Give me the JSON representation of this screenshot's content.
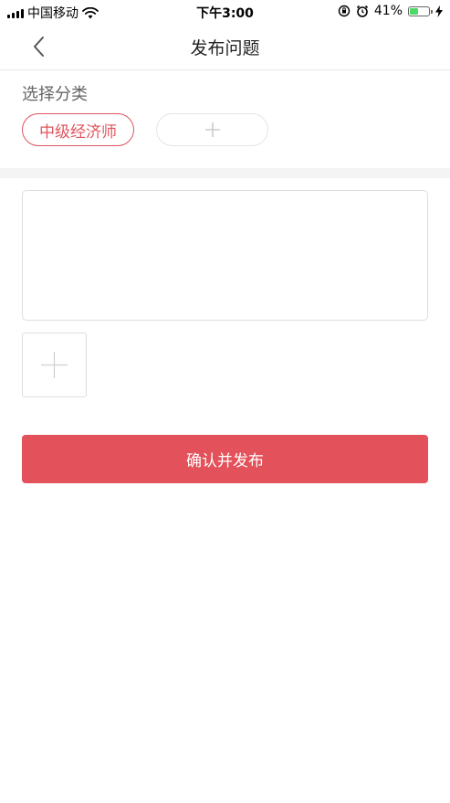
{
  "status_bar": {
    "carrier": "中国移动",
    "time": "下午3:00",
    "battery_percent": "41%",
    "battery_level": 0.41,
    "icons": [
      "signal-icon",
      "wifi-icon",
      "orientation-lock-icon",
      "alarm-icon",
      "battery-icon",
      "charging-icon"
    ]
  },
  "nav": {
    "title": "发布问题",
    "back_icon": "chevron-left-icon"
  },
  "category": {
    "label": "选择分类",
    "selected": "中级经济师",
    "add_icon": "plus-icon"
  },
  "content": {
    "placeholder": "",
    "image_add_icon": "plus-icon"
  },
  "submit": {
    "label": "确认并发布"
  },
  "colors": {
    "accent": "#e3515b",
    "chip_border": "#e0545e",
    "divider": "#f4f4f4"
  }
}
